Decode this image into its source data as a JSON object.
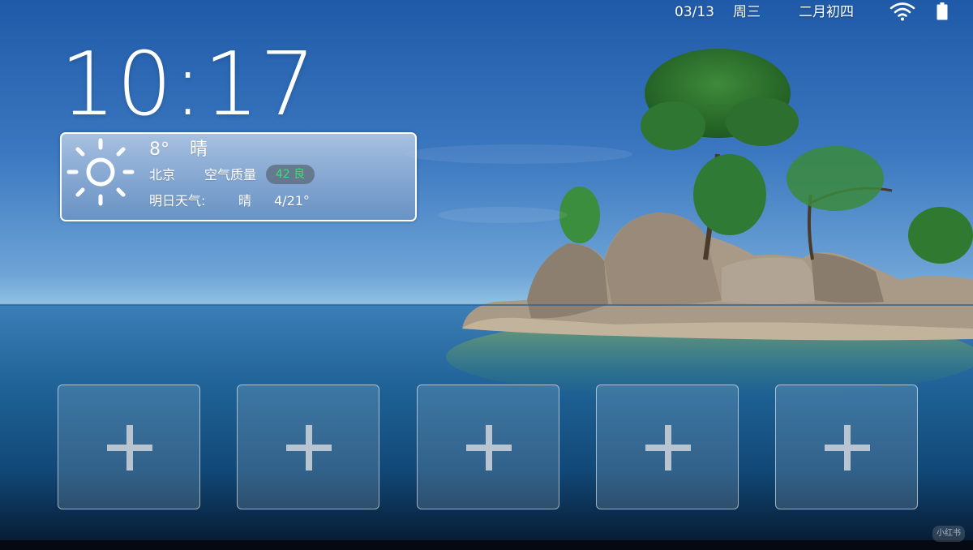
{
  "status_bar": {
    "date": "03/13",
    "weekday": "周三",
    "lunar_date": "二月初四",
    "wifi_icon": "wifi-icon",
    "battery_icon": "battery-icon"
  },
  "clock": {
    "time": "10:17"
  },
  "weather": {
    "icon": "sun-icon",
    "temperature": "8°",
    "condition": "晴",
    "city": "北京",
    "air_quality_label": "空气质量",
    "air_quality_value": "42 良",
    "tomorrow_label": "明日天气:",
    "tomorrow_condition": "晴",
    "tomorrow_temperature": "4/21°"
  },
  "app_slots": [
    {
      "icon": "plus-icon"
    },
    {
      "icon": "plus-icon"
    },
    {
      "icon": "plus-icon"
    },
    {
      "icon": "plus-icon"
    },
    {
      "icon": "plus-icon"
    }
  ],
  "watermark": "小红书",
  "colors": {
    "air_quality_good": "#3ddc78",
    "text": "#ffffff"
  }
}
